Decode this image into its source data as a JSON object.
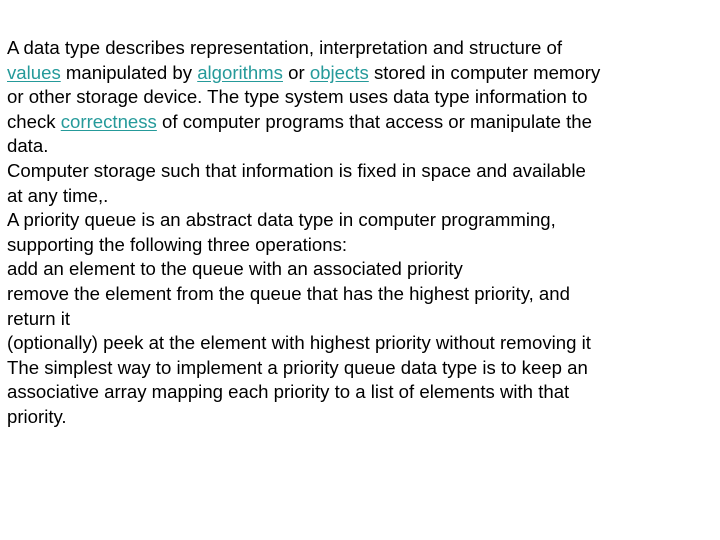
{
  "colors": {
    "text": "#000000",
    "link": "#259a9a",
    "background": "#ffffff"
  },
  "paragraph1": {
    "line1": "A data type describes representation, interpretation and structure of",
    "line2": {
      "link1": "values",
      "text1": " manipulated by ",
      "link2": "algorithms",
      "text2": " or ",
      "link3": "objects",
      "text3": " stored in computer memory"
    },
    "line3": "or other storage device. The type system uses data type information to",
    "line4": {
      "text1": "check ",
      "link1": "correctness",
      "text2": " of computer programs that access or manipulate the"
    },
    "line5": "data."
  },
  "paragraph2": {
    "line1": "Computer storage such that information is fixed in space and available",
    "line2": "at any time,."
  },
  "paragraph3": {
    "line1": "A priority queue is an abstract data type in computer programming,",
    "line2": "supporting the following three operations:",
    "line3": "add an element to the queue with an associated priority",
    "line4": "remove the element from the queue that has the highest priority, and",
    "line5": "return it",
    "line6": "(optionally) peek at the element with highest priority without removing it"
  },
  "paragraph4": {
    "line1": "The simplest way to implement a priority queue data type is to keep an",
    "line2": "associative array mapping each priority to a list of elements with that",
    "line3": "priority."
  }
}
